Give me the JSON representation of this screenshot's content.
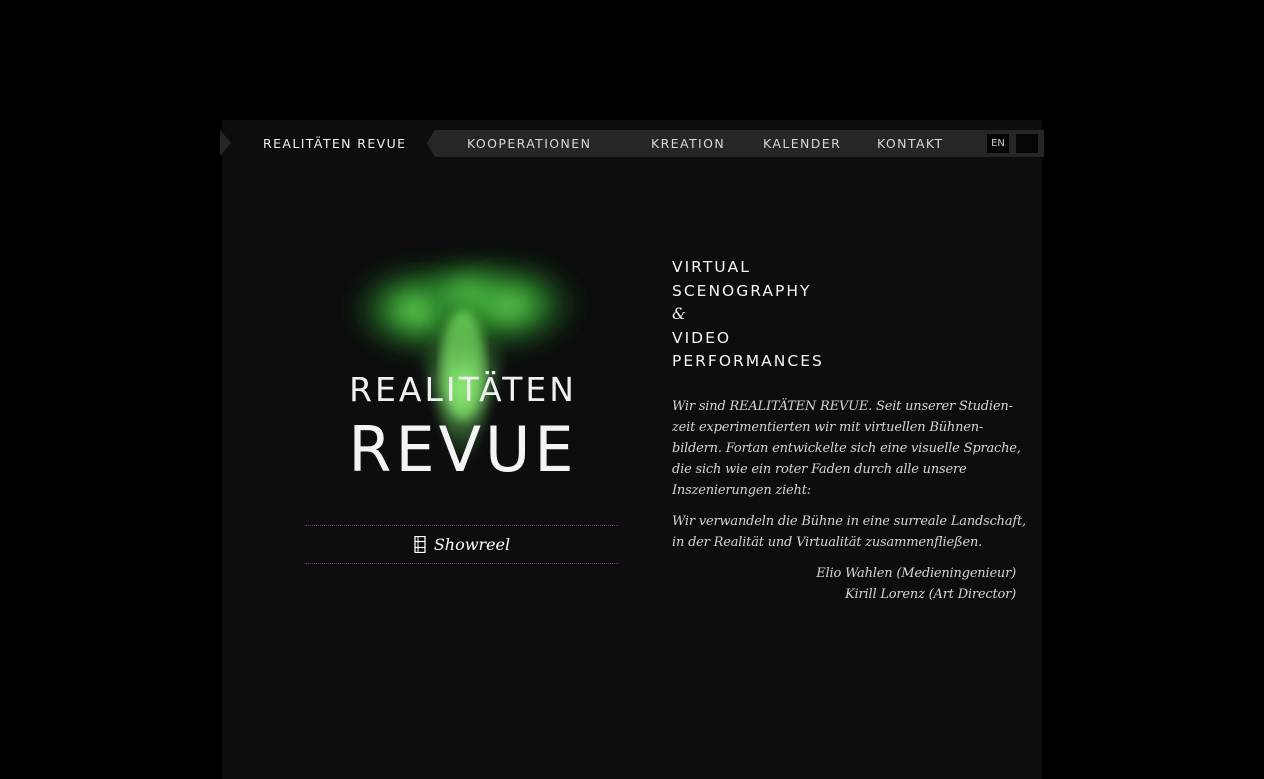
{
  "nav": {
    "items": [
      {
        "label": "REALITÄTEN REVUE"
      },
      {
        "label": "KOOPERATIONEN"
      },
      {
        "label": "KREATION"
      },
      {
        "label": "KALENDER"
      },
      {
        "label": "KONTAKT"
      }
    ],
    "lang": {
      "en": "EN"
    }
  },
  "logo": {
    "line1": "REALITÄTEN",
    "line2": "REVUE",
    "glow_color": "#3dbb3a"
  },
  "showreel": {
    "label": "Showreel",
    "icon": "film-strip-icon",
    "border_color": "#7a2a8a"
  },
  "headline": {
    "lines": [
      "VIRTUAL",
      "SCENOGRAPHY",
      "&",
      "VIDEO",
      "PERFORMANCES"
    ]
  },
  "intro": {
    "lines": [
      "Wir sind REALITÄTEN REVUE. Seit unserer Studien-",
      "zeit experimentierten wir mit virtuellen Bühnen-",
      "bildern. Fortan entwickelte sich eine visuelle Sprache,",
      "die sich wie ein roter Faden durch alle unsere",
      "Inszenierungen zieht:"
    ]
  },
  "mission": {
    "lines": [
      "Wir verwandeln die Bühne in eine surreale Landschaft,",
      "in der Realität und Virtualität zusammenfließen."
    ]
  },
  "signatures": [
    "Elio Wahlen (Medieningenieur)",
    "Kirill Lorenz (Art Director)"
  ]
}
